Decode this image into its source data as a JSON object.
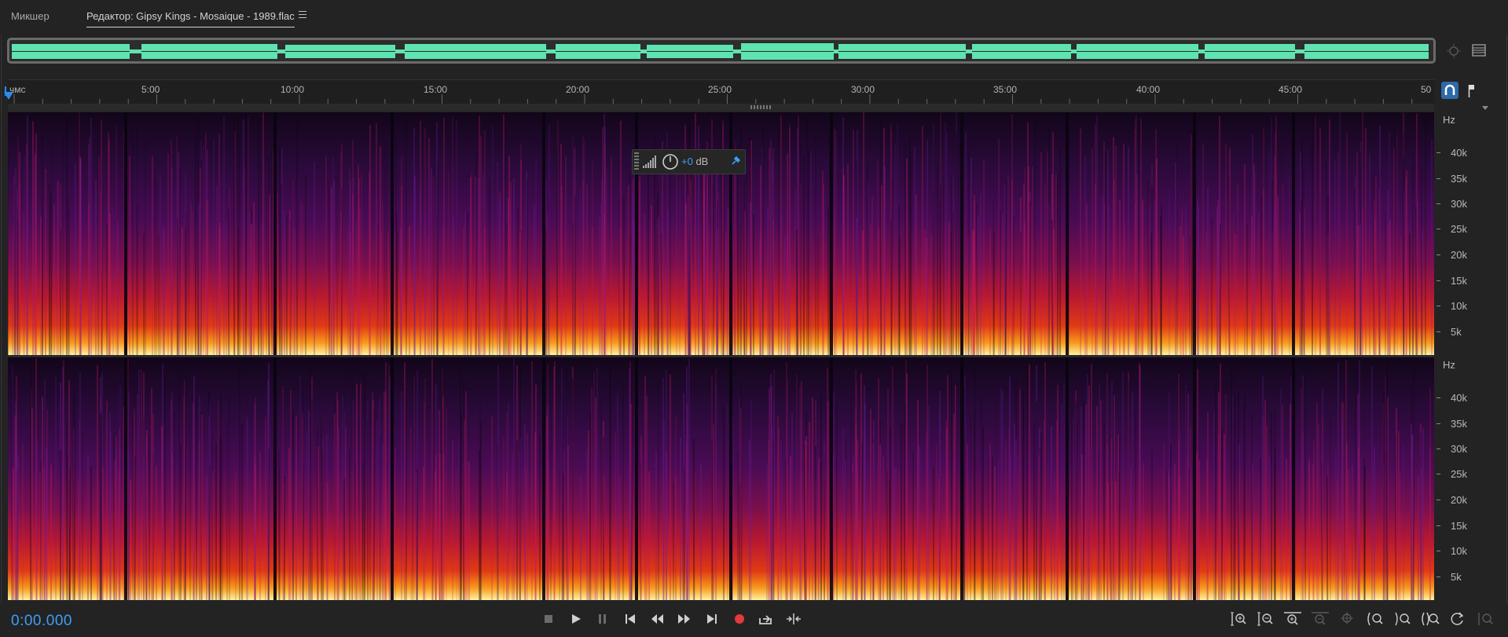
{
  "tabs": [
    {
      "label": "Микшер"
    },
    {
      "label": "Редактор: Gipsy Kings - Mosaique - 1989.flac"
    }
  ],
  "ruler": {
    "unit_label": "чмс",
    "ticks": [
      "5:00",
      "10:00",
      "15:00",
      "20:00",
      "25:00",
      "30:00",
      "35:00",
      "40:00",
      "45:00",
      "50"
    ]
  },
  "hz_scale": {
    "unit": "Hz",
    "labels": [
      "40k",
      "35k",
      "30k",
      "25k",
      "20k",
      "15k",
      "10k",
      "5k"
    ]
  },
  "hud": {
    "value": "+0",
    "unit": "dB"
  },
  "timecode": "0:00.000",
  "colors": {
    "accent": "#3f9ef5",
    "waveform": "#5fe3b0",
    "record": "#e23b3b"
  },
  "transport_icons": [
    "stop-icon",
    "play-icon",
    "pause-icon",
    "go-to-start-icon",
    "rewind-icon",
    "fast-forward-icon",
    "go-to-end-icon",
    "record-icon",
    "loop-playback-icon",
    "skip-selection-icon"
  ],
  "zoom_icons": [
    "zoom-in-amplitude-icon",
    "zoom-out-amplitude-icon",
    "zoom-in-time-icon",
    "zoom-out-time-icon",
    "zoom-full-icon",
    "zoom-in-at-start-icon",
    "zoom-in-at-end-icon",
    "zoom-to-selection-icon",
    "zoom-reset-icon",
    "zoom-out-full-icon"
  ]
}
